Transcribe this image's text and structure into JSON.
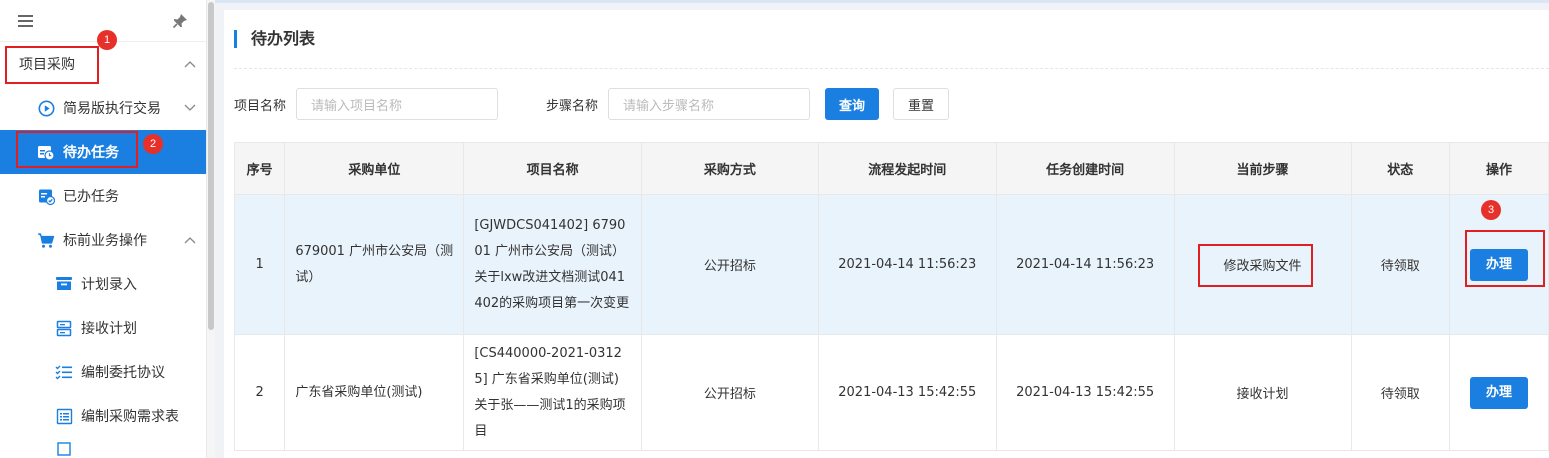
{
  "sidebar": {
    "items": [
      {
        "label": "项目采购",
        "level": 0,
        "icon": "none",
        "chevron": "up"
      },
      {
        "label": "简易版执行交易",
        "level": 1,
        "icon": "play-circle-icon",
        "chevron": "down"
      },
      {
        "label": "待办任务",
        "level": 1,
        "icon": "calendar-clock-icon",
        "active": true
      },
      {
        "label": "已办任务",
        "level": 1,
        "icon": "task-done-icon"
      },
      {
        "label": "标前业务操作",
        "level": 1,
        "icon": "cart-icon",
        "chevron": "up"
      },
      {
        "label": "计划录入",
        "level": 2,
        "icon": "inbox-icon"
      },
      {
        "label": "接收计划",
        "level": 2,
        "icon": "server-icon"
      },
      {
        "label": "编制委托协议",
        "level": 2,
        "icon": "checklist-icon"
      },
      {
        "label": "编制采购需求表",
        "level": 2,
        "icon": "list-icon"
      }
    ]
  },
  "annotations": [
    "1",
    "2",
    "3"
  ],
  "page": {
    "title": "待办列表"
  },
  "search": {
    "project_label": "项目名称",
    "project_placeholder": "请输入项目名称",
    "step_label": "步骤名称",
    "step_placeholder": "请输入步骤名称",
    "query_label": "查询",
    "reset_label": "重置"
  },
  "table": {
    "headers": [
      "序号",
      "采购单位",
      "项目名称",
      "采购方式",
      "流程发起时间",
      "任务创建时间",
      "当前步骤",
      "状态",
      "操作"
    ],
    "rows": [
      {
        "index": "1",
        "unit": "679001 广州市公安局（测试）",
        "project": "[GJWDCS041402] 679001 广州市公安局（测试）关于lxw改进文档测试041402的采购项目第一次变更",
        "method": "公开招标",
        "start_time": "2021-04-14 11:56:23",
        "create_time": "2021-04-14 11:56:23",
        "step": "修改采购文件",
        "status": "待领取",
        "action": "办理"
      },
      {
        "index": "2",
        "unit": "广东省采购单位(测试)",
        "project": "[CS440000-2021-03125] 广东省采购单位(测试)关于张——测试1的采购项目",
        "method": "公开招标",
        "start_time": "2021-04-13 15:42:55",
        "create_time": "2021-04-13 15:42:55",
        "step": "接收计划",
        "status": "待领取",
        "action": "办理"
      }
    ]
  },
  "colors": {
    "accent": "#1a7fe0",
    "annotation": "#e02020",
    "row_highlight": "#e9f3fc"
  }
}
